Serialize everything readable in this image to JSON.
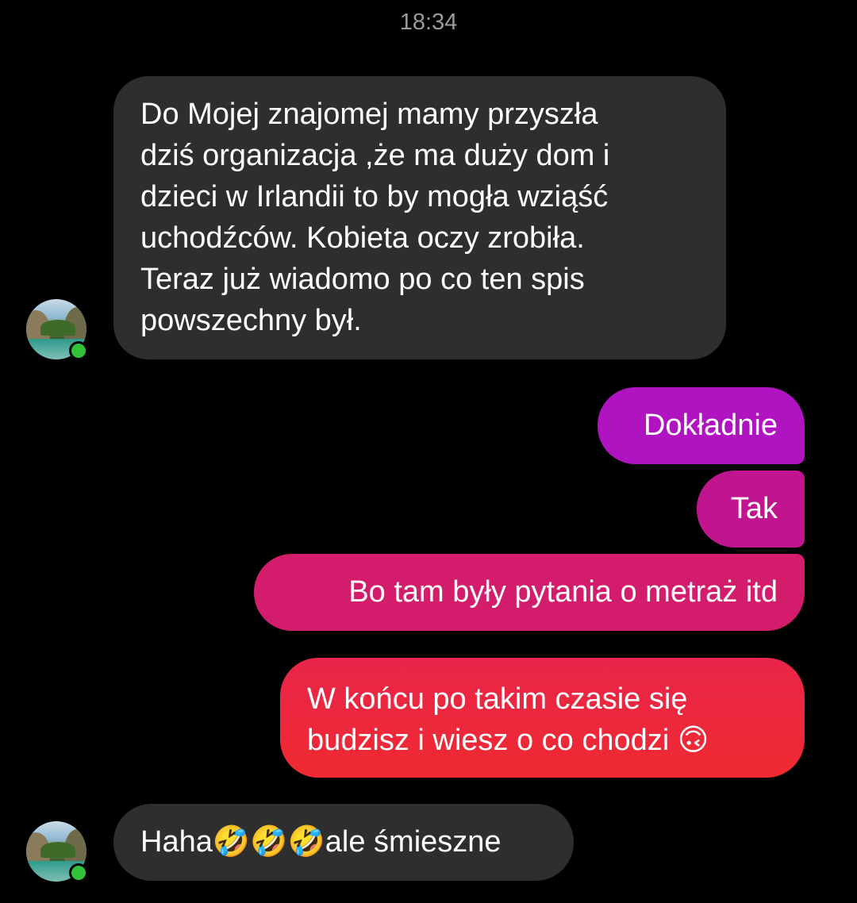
{
  "timestamp": "18:34",
  "messages": [
    {
      "direction": "incoming",
      "lines": [
        "Do Mojej znajomej mamy przyszła",
        "dziś organizacja ,że ma duży dom i",
        "dzieci w Irlandii to by mogła wziąść",
        "uchodźców. Kobieta oczy zrobiła.",
        "Teraz już wiadomo po co ten spis",
        "powszechny był."
      ]
    },
    {
      "direction": "outgoing",
      "text": "Dokładnie",
      "color": "#b013c0"
    },
    {
      "direction": "outgoing",
      "text": "Tak",
      "color": "#c0158f"
    },
    {
      "direction": "outgoing",
      "text": "Bo tam były pytania o metraż itd",
      "color": "#d31d6c"
    },
    {
      "direction": "outgoing",
      "lines": [
        "W końcu po takim czasie się",
        "budzisz i wiesz o co chodzi 🙃"
      ],
      "color": "#ee2840"
    },
    {
      "direction": "incoming",
      "text": "Haha🤣🤣🤣ale śmieszne"
    }
  ],
  "colors": {
    "background": "#000000",
    "incoming_bubble": "#2e2e2e",
    "online_dot": "#31c23a"
  },
  "icons": [
    "contact-avatar",
    "online-status-dot"
  ]
}
